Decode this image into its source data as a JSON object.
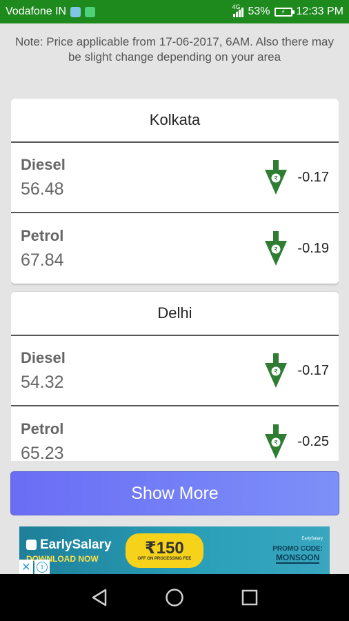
{
  "status_bar": {
    "carrier": "Vodafone IN",
    "network": "4G",
    "battery_percent": "53%",
    "time": "12:33 PM",
    "bg_color": "#1e8a1e"
  },
  "note": {
    "text": "Note: Price applicable from 17-06-2017, 6AM. Also there may be slight change depending on your area"
  },
  "cities": [
    {
      "name": "Kolkata",
      "fuels": [
        {
          "name": "Diesel",
          "price": "56.48",
          "change": "-0.17",
          "icon": "price-down-arrow-icon"
        },
        {
          "name": "Petrol",
          "price": "67.84",
          "change": "-0.19",
          "icon": "price-down-arrow-icon"
        }
      ]
    },
    {
      "name": "Delhi",
      "fuels": [
        {
          "name": "Diesel",
          "price": "54.32",
          "change": "-0.17",
          "icon": "price-down-arrow-icon"
        },
        {
          "name": "Petrol",
          "price": "65.23",
          "change": "-0.25",
          "icon": "price-down-arrow-icon"
        }
      ]
    }
  ],
  "show_more": {
    "label": "Show More"
  },
  "ad": {
    "brand": "EarlySalary",
    "cta": "DOWNLOAD NOW",
    "amount": "₹150",
    "amount_sub": "OFF ON PROCESSING FEE",
    "corner_brand": "EarlySalary",
    "promo_label": "PROMO CODE:",
    "promo_code": "MONSOON",
    "close_glyph": "✕",
    "info_glyph": "i"
  },
  "colors": {
    "accent_green": "#1e8a1e",
    "arrow_green": "#2e7d32",
    "button_blue": "#6a6df5"
  }
}
